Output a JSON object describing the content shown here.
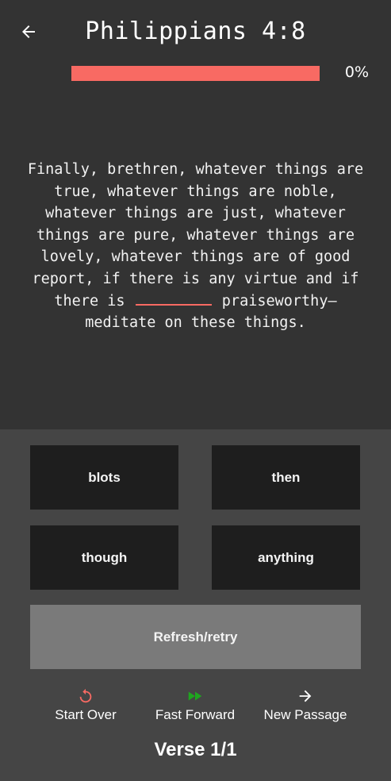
{
  "header": {
    "back_icon": "arrow-left-icon",
    "title": "Philippians 4:8"
  },
  "progress": {
    "percent": 0,
    "label": "0%",
    "bar_color": "#f86a63"
  },
  "verse": {
    "before_blank": "Finally, brethren, whatever things are true, whatever things are noble, whatever things are just, whatever things are pure, whatever things are lovely, whatever things are of good report, if there is any virtue and if there is",
    "after_blank": "praiseworthy—meditate on these things."
  },
  "choices": [
    "blots",
    "then",
    "though",
    "anything"
  ],
  "refresh_label": "Refresh/retry",
  "actions": [
    {
      "icon": "restart-icon",
      "label": "Start Over",
      "color": "#f86a63"
    },
    {
      "icon": "fast-forward-icon",
      "label": "Fast Forward",
      "color": "#1fa51f"
    },
    {
      "icon": "arrow-right-icon",
      "label": "New Passage",
      "color": "#ffffff"
    }
  ],
  "verse_counter": "Verse 1/1"
}
